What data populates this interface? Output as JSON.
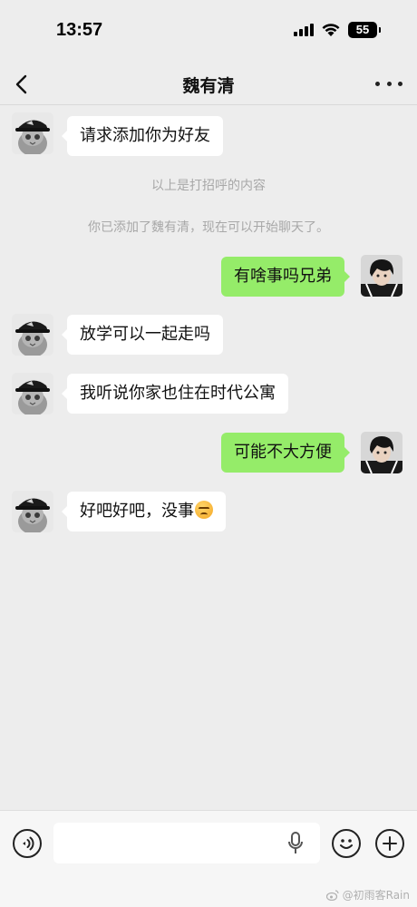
{
  "status_bar": {
    "time": "13:57",
    "battery": "55"
  },
  "nav": {
    "title": "魏有清",
    "back_icon": "chevron-left-icon",
    "more_icon": "more-dots-icon"
  },
  "messages": [
    {
      "from": "contact",
      "type": "text",
      "text": "请求添加你为好友"
    },
    {
      "from": "system",
      "text": "以上是打招呼的内容"
    },
    {
      "from": "system",
      "text": "你已添加了魏有清，现在可以开始聊天了。"
    },
    {
      "from": "me",
      "type": "text",
      "text": "有啥事吗兄弟"
    },
    {
      "from": "contact",
      "type": "text",
      "text": "放学可以一起走吗"
    },
    {
      "from": "contact",
      "type": "text",
      "text": "我听说你家也住在时代公寓"
    },
    {
      "from": "me",
      "type": "text",
      "text": "可能不大方便"
    },
    {
      "from": "contact",
      "type": "text",
      "text": "好吧好吧，没事",
      "emoji": "grimace-emoji"
    }
  ],
  "input_bar": {
    "value": "",
    "voice_icon": "voice-icon",
    "mic_icon": "mic-icon",
    "emoji_icon": "smiley-icon",
    "plus_icon": "plus-icon"
  },
  "watermark": "@初雨客Rain",
  "colors": {
    "background": "#ededed",
    "incoming_bubble": "#ffffff",
    "outgoing_bubble": "#95ec69",
    "system_text": "#a8a8a8"
  }
}
